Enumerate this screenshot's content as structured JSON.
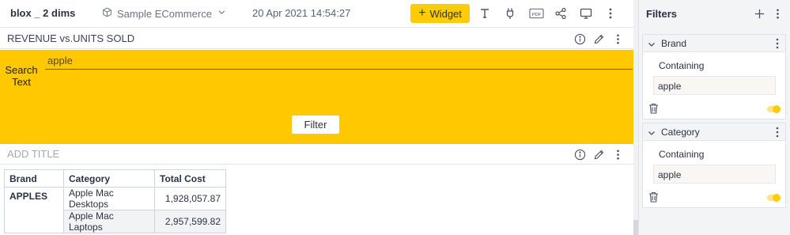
{
  "toolbar": {
    "dashboard_title": "blox _ 2 dims",
    "datasource": "Sample ECommerce",
    "timestamp": "20 Apr 2021 14:54:27",
    "widget_button": "Widget",
    "pdf_label": "PDF",
    "accent_color": "#ffcb05"
  },
  "widget1": {
    "title": "REVENUE vs.UNITS SOLD",
    "search_label_line1": "Search",
    "search_label_line2": "Text",
    "search_value": "apple",
    "filter_button": "Filter",
    "background_color": "#ffc800"
  },
  "widget2": {
    "title": "ADD TITLE",
    "table": {
      "headers": [
        "Brand",
        "Category",
        "Total Cost"
      ],
      "brand": "APPLES",
      "rows": [
        {
          "category": "Apple Mac Desktops",
          "total_cost": "1,928,057.87"
        },
        {
          "category": "Apple Mac Laptops",
          "total_cost": "2,957,599.82"
        }
      ]
    }
  },
  "filters_panel": {
    "title": "Filters",
    "cards": [
      {
        "title": "Brand",
        "mode": "Containing",
        "value": "apple",
        "enabled": true
      },
      {
        "title": "Category",
        "mode": "Containing",
        "value": "apple",
        "enabled": true
      }
    ]
  }
}
